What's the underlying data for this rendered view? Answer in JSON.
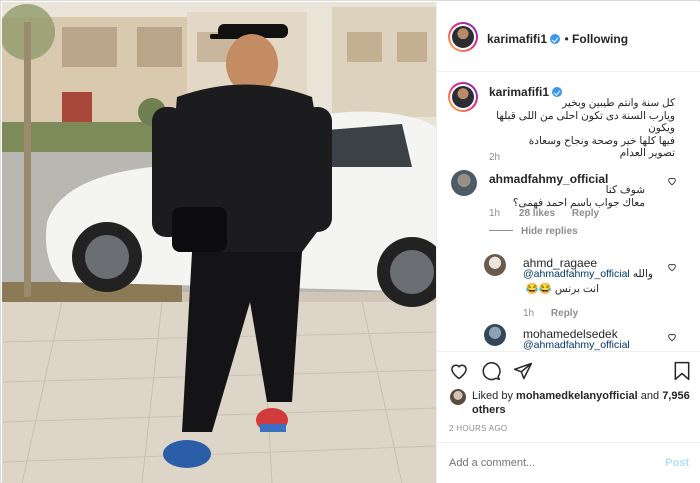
{
  "post": {
    "author": "karimafifi1",
    "follow_label": "Following",
    "caption_lines": [
      "كل سنة وانتم طيبين وبخير",
      "ويارب السنة دى تكون احلى من اللى قبلها ويكون",
      "فيها كلها خير وصحة ونجاح وسعادة",
      "تصوير العدام"
    ],
    "caption_time": "2h"
  },
  "comments": [
    {
      "user": "ahmadfahmy_official",
      "lines": [
        "شوف كنا",
        "معاك جواب باسم احمد فهمى؟"
      ],
      "time": "1h",
      "likes": "28 likes",
      "reply": "Reply",
      "hide_replies": "Hide replies"
    },
    {
      "user": "ahmd_ragaee",
      "mention": "@ahmadfahmy_official",
      "text_after_mention": "والله",
      "line2": "انت برنس 😂😂",
      "time": "1h",
      "reply": "Reply"
    },
    {
      "user": "mohamedelsedek",
      "mention": "@ahmadfahmy_official"
    }
  ],
  "likes": {
    "liked_by_prefix": "Liked by",
    "liked_by_user": "mohamedkelanyofficial",
    "and": "and",
    "others": "7,956 others",
    "timestamp": "2 HOURS AGO"
  },
  "add_comment": {
    "placeholder": "Add a comment...",
    "post_label": "Post"
  },
  "colors": {
    "link": "#00376b",
    "verified": "#3897f0",
    "post_disabled": "#b2dffc"
  },
  "icons": [
    "heart-icon",
    "comment-icon",
    "share-icon",
    "bookmark-icon",
    "verified-badge-icon"
  ]
}
